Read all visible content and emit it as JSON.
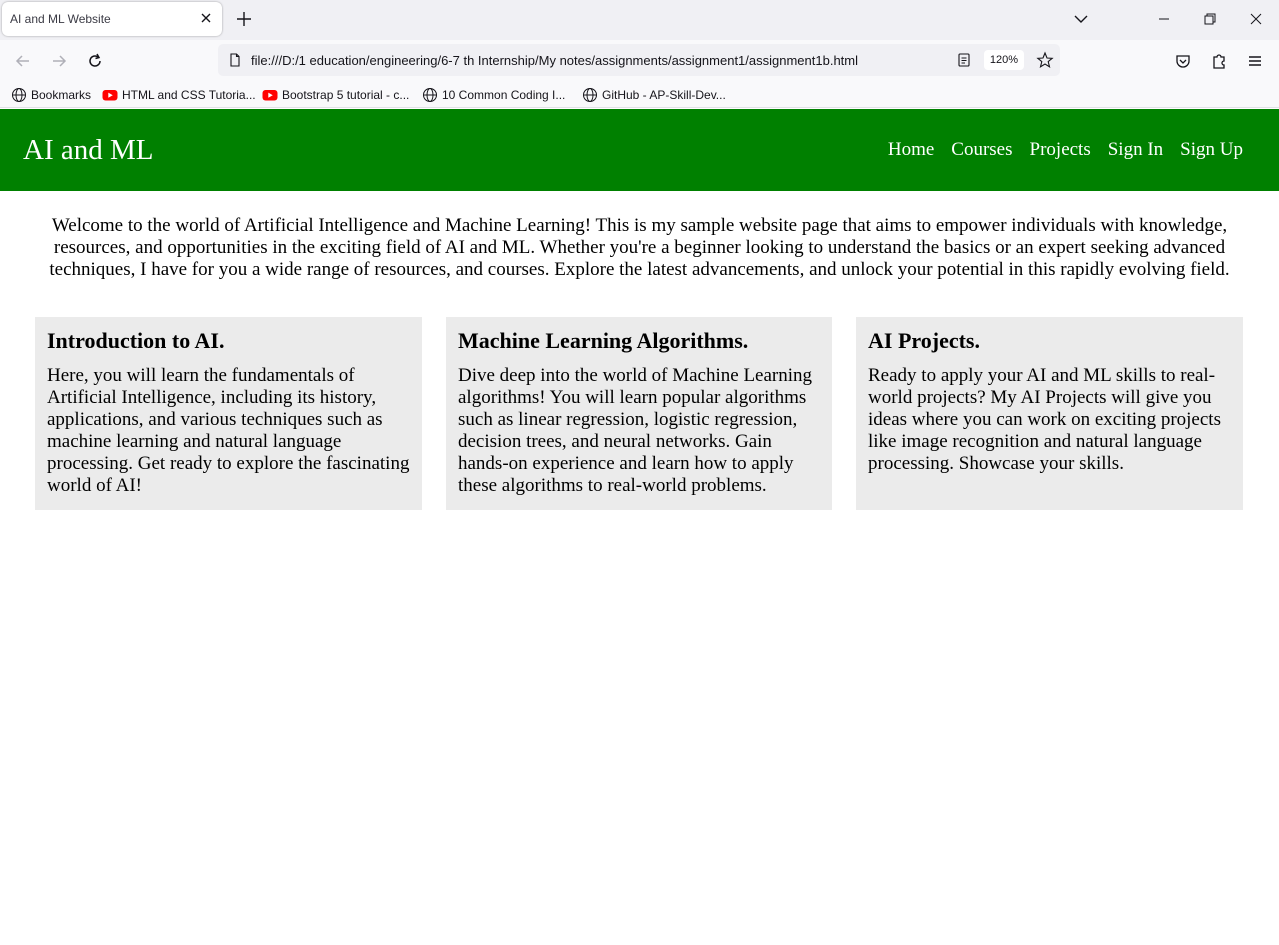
{
  "browser": {
    "tab_title": "AI and ML Website",
    "url": "file:///D:/1 education/engineering/6-7 th Internship/My notes/assignments/assignment1/assignment1b.html",
    "zoom": "120%",
    "bookmarks": [
      {
        "label": "Bookmarks",
        "icon": "globe-icon"
      },
      {
        "label": "HTML and CSS Tutoria...",
        "icon": "youtube-icon"
      },
      {
        "label": "Bootstrap 5 tutorial - c...",
        "icon": "youtube-icon"
      },
      {
        "label": "10 Common Coding I...",
        "icon": "globe-icon"
      },
      {
        "label": "GitHub - AP-Skill-Dev...",
        "icon": "globe-icon"
      }
    ]
  },
  "site": {
    "title": "AI and ML",
    "nav": [
      "Home",
      "Courses",
      "Projects",
      "Sign In",
      "Sign Up"
    ],
    "header_color": "#008000",
    "intro": "Welcome to the world of Artificial Intelligence and Machine Learning! This is my sample website page that aims to empower individuals with knowledge, resources, and opportunities in the exciting field of AI and ML. Whether you're a beginner looking to understand the basics or an expert seeking advanced techniques, I have for you a wide range of resources, and courses. Explore the latest advancements, and unlock your potential in this rapidly evolving field.",
    "cards": [
      {
        "title": "Introduction to AI.",
        "text": "Here, you will learn the fundamentals of Artificial Intelligence, including its history, applications, and various techniques such as machine learning and natural language processing. Get ready to explore the fascinating world of AI!"
      },
      {
        "title": "Machine Learning Algorithms.",
        "text": "Dive deep into the world of Machine Learning algorithms! You will learn popular algorithms such as linear regression, logistic regression, decision trees, and neural networks. Gain hands-on experience and learn how to apply these algorithms to real-world problems."
      },
      {
        "title": "AI Projects.",
        "text": "Ready to apply your AI and ML skills to real-world projects? My AI Projects will give you ideas where you can work on exciting projects like image recognition and natural language processing. Showcase your skills."
      }
    ]
  }
}
